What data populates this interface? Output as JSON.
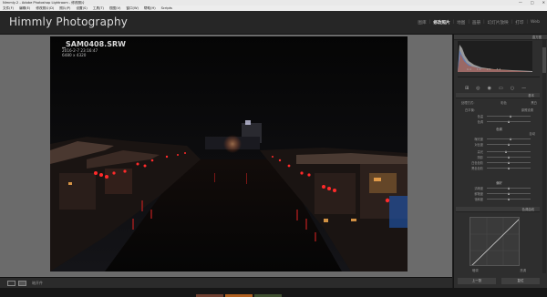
{
  "window": {
    "title": "Nimmly-2 - Adobe Photoshop Lightroom - 修改照片",
    "controls": [
      "—",
      "□",
      "✕"
    ]
  },
  "menu": [
    "文件(F)",
    "编辑(E)",
    "修改照片(D)",
    "照片(P)",
    "设置(S)",
    "工具(T)",
    "视图(V)",
    "窗口(W)",
    "帮助(H)",
    "Scripts"
  ],
  "identity_plate": "Himmly Photography",
  "modules": [
    {
      "label": "图库",
      "active": false
    },
    {
      "label": "修改照片",
      "active": true
    },
    {
      "label": "地图",
      "active": false
    },
    {
      "label": "画册",
      "active": false
    },
    {
      "label": "幻灯片放映",
      "active": false
    },
    {
      "label": "打印",
      "active": false
    },
    {
      "label": "Web",
      "active": false
    }
  ],
  "photo_info": {
    "filename": "_SAM0408.SRW",
    "datetime": "2016-2-7 23:16:47",
    "dimensions": "6480 x 4320"
  },
  "right_panel": {
    "histogram_label": "直方图",
    "histogram_values": [
      "0.4",
      "1.9",
      "1.5",
      "3.4"
    ],
    "basic_label": "基本",
    "treatment_label": "处理方式：",
    "treatment_options": [
      "彩色",
      "黑白"
    ],
    "wb_label": "白平衡：",
    "wb_value": "原照设置",
    "tone_label": "色调",
    "tone_auto": "自动",
    "presence_label": "偏好",
    "sliders": [
      {
        "label": "色温",
        "value": 0.55
      },
      {
        "label": "色调",
        "value": 0.52
      },
      {
        "label": "曝光度",
        "value": 0.55
      },
      {
        "label": "对比度",
        "value": 0.5
      },
      {
        "label": "高光",
        "value": 0.45
      },
      {
        "label": "阴影",
        "value": 0.5
      },
      {
        "label": "白色色阶",
        "value": 0.5
      },
      {
        "label": "黑色色阶",
        "value": 0.5
      },
      {
        "label": "清晰度",
        "value": 0.52
      },
      {
        "label": "鲜艳度",
        "value": 0.5
      },
      {
        "label": "饱和度",
        "value": 0.5
      }
    ],
    "tone_curve_label": "色调曲线",
    "curve_axes": [
      "暗调",
      "亮调"
    ],
    "buttons": {
      "previous": "上一张",
      "reset": "复位"
    }
  },
  "bottom_bar": {
    "filter_label": "暗开件"
  },
  "colors": {
    "accent": "#e8e8e8",
    "panel": "#2e2e2e",
    "canvas": "#6b6b6b"
  }
}
